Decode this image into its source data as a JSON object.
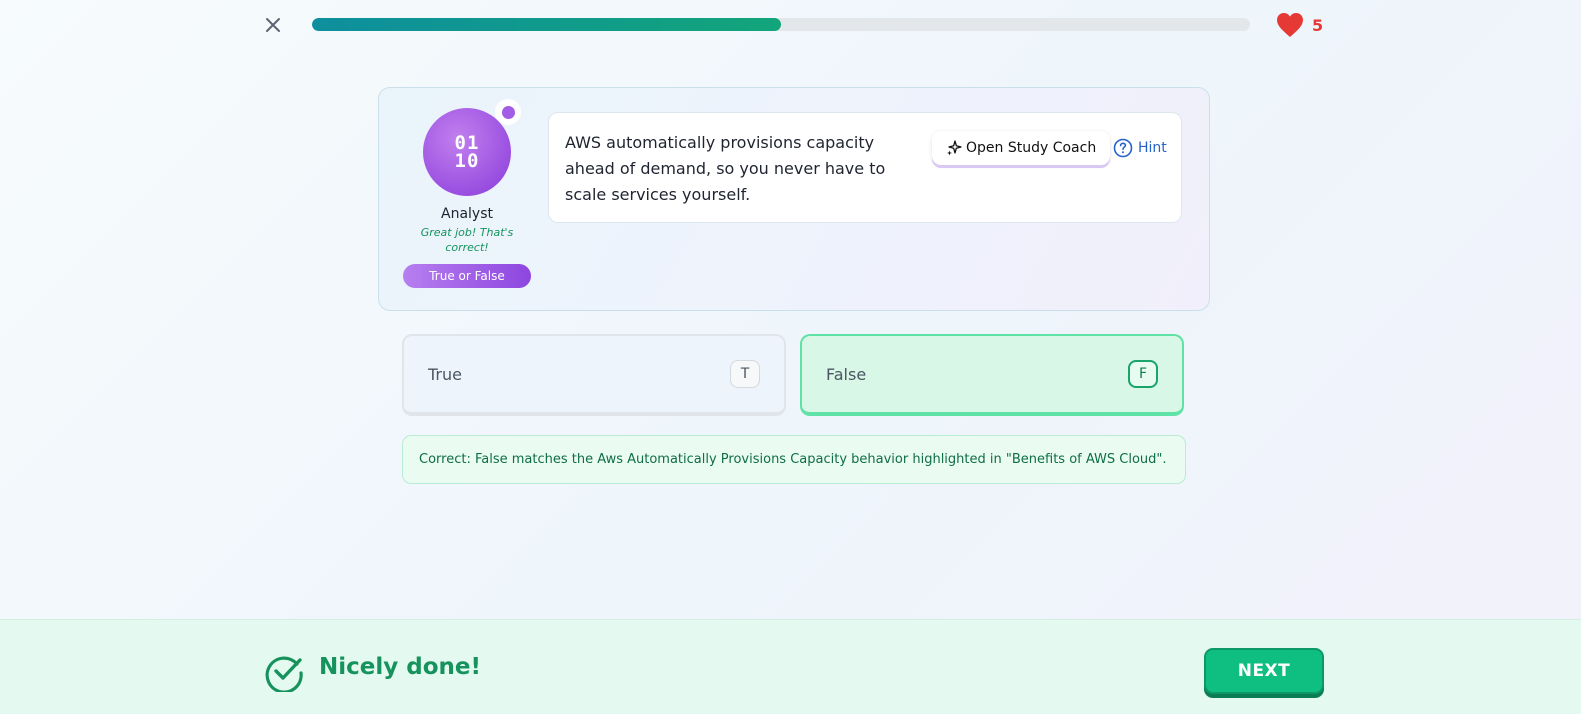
{
  "header": {
    "close_icon": "close-icon",
    "progress": 0.5,
    "lives_icon": "heart-icon",
    "lives_count": "5"
  },
  "character": {
    "avatar_glyph": "01\n10",
    "name": "Analyst",
    "message": "Great job! That's correct!",
    "question_type": "True or False"
  },
  "question": {
    "text": "AWS automatically provisions capacity ahead of demand, so you never have to scale services yourself.",
    "coach_label": "Open Study Coach",
    "coach_icon": "sparkles-icon",
    "hint_label": "Hint",
    "hint_icon": "question-circle-icon"
  },
  "options": [
    {
      "label": "True",
      "key": "T",
      "state": "default"
    },
    {
      "label": "False",
      "key": "F",
      "state": "selected-correct"
    }
  ],
  "feedback": {
    "text": "Correct: False matches the Aws Automatically Provisions Capacity behavior highlighted in \"Benefits of AWS Cloud\"."
  },
  "footer": {
    "status_icon": "check-circle-icon",
    "message": "Nicely done!",
    "next_label": "NEXT"
  },
  "colors": {
    "accent_green": "#16935d",
    "heart_red": "#e53935",
    "avatar_purple": "#9a4fe0",
    "next_button": "#0fbf82"
  }
}
